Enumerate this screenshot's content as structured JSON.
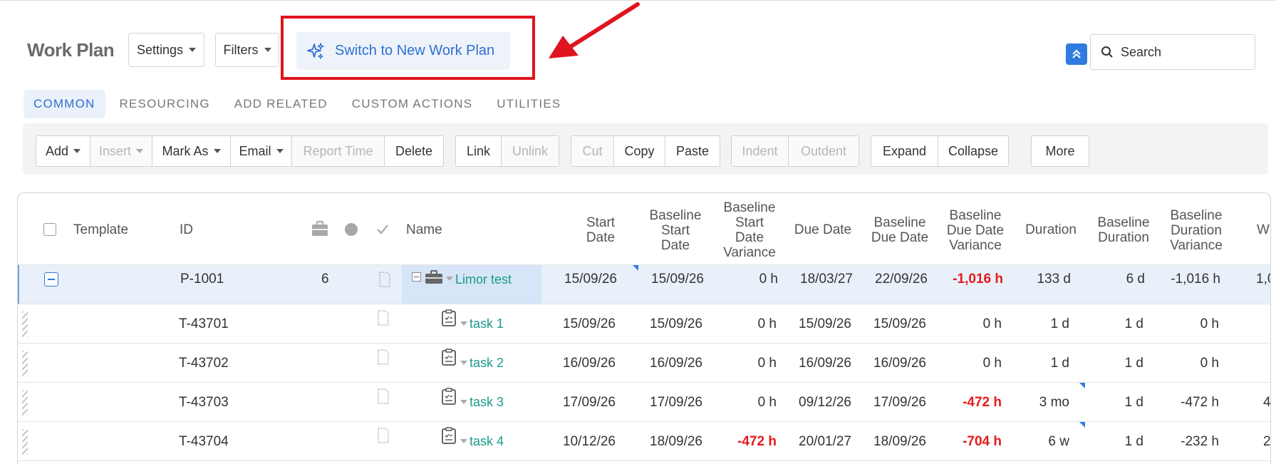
{
  "header": {
    "title": "Work Plan",
    "settings_label": "Settings",
    "filters_label": "Filters",
    "switch_label": "Switch to New Work Plan",
    "search_placeholder": "Search"
  },
  "tabs": [
    {
      "label": "COMMON",
      "active": true
    },
    {
      "label": "RESOURCING",
      "active": false
    },
    {
      "label": "ADD RELATED",
      "active": false
    },
    {
      "label": "CUSTOM ACTIONS",
      "active": false
    },
    {
      "label": "UTILITIES",
      "active": false
    }
  ],
  "toolbar": {
    "add": "Add",
    "insert": "Insert",
    "mark_as": "Mark As",
    "email": "Email",
    "report_time": "Report Time",
    "delete": "Delete",
    "link": "Link",
    "unlink": "Unlink",
    "cut": "Cut",
    "copy": "Copy",
    "paste": "Paste",
    "indent": "Indent",
    "outdent": "Outdent",
    "expand": "Expand",
    "collapse": "Collapse",
    "more": "More"
  },
  "grid": {
    "headers": {
      "template": "Template",
      "id": "ID",
      "name": "Name",
      "start_date_1": "Start",
      "start_date_2": "Date",
      "bsd_1": "Baseline",
      "bsd_2": "Start",
      "bsd_3": "Date",
      "bsdv_1": "Baseline",
      "bsdv_2": "Start",
      "bsdv_3": "Date",
      "bsdv_4": "Variance",
      "due_date": "Due Date",
      "bdd_1": "Baseline",
      "bdd_2": "Due Date",
      "bddv_1": "Baseline",
      "bddv_2": "Due Date",
      "bddv_3": "Variance",
      "duration": "Duration",
      "bdur_1": "Baseline",
      "bdur_2": "Duration",
      "bdurv_1": "Baseline",
      "bdurv_2": "Duration",
      "bdurv_3": "Variance",
      "next_partial": "W"
    },
    "rows": [
      {
        "id": "P-1001",
        "count": "6",
        "name": "Limor test",
        "start": "15/09/26",
        "bstart": "15/09/26",
        "bsv": "0 h",
        "due": "18/03/27",
        "bdue": "22/09/26",
        "bddv": "-1,016 h",
        "duration": "133 d",
        "bdur": "6 d",
        "bdurv": "-1,016 h",
        "next": "1,0"
      },
      {
        "id": "T-43701",
        "name": "task 1",
        "start": "15/09/26",
        "bstart": "15/09/26",
        "bsv": "0 h",
        "due": "15/09/26",
        "bdue": "15/09/26",
        "bddv": "0 h",
        "duration": "1 d",
        "bdur": "1 d",
        "bdurv": "0 h",
        "next": ""
      },
      {
        "id": "T-43702",
        "name": "task 2",
        "start": "16/09/26",
        "bstart": "16/09/26",
        "bsv": "0 h",
        "due": "16/09/26",
        "bdue": "16/09/26",
        "bddv": "0 h",
        "duration": "1 d",
        "bdur": "1 d",
        "bdurv": "0 h",
        "next": ""
      },
      {
        "id": "T-43703",
        "name": "task 3",
        "start": "17/09/26",
        "bstart": "17/09/26",
        "bsv": "0 h",
        "due": "09/12/26",
        "bdue": "17/09/26",
        "bddv": "-472 h",
        "duration": "3 mo",
        "bdur": "1 d",
        "bdurv": "-472 h",
        "next": "4"
      },
      {
        "id": "T-43704",
        "name": "task 4",
        "start": "10/12/26",
        "bstart": "18/09/26",
        "bsv": "-472 h",
        "due": "20/01/27",
        "bdue": "18/09/26",
        "bddv": "-704 h",
        "duration": "6 w",
        "bdur": "1 d",
        "bdurv": "-232 h",
        "next": "2"
      }
    ]
  },
  "colors": {
    "accent": "#2f6fd1",
    "negative": "#e31b1b",
    "link": "#1a9a8a",
    "highlight": "#e0141e"
  }
}
